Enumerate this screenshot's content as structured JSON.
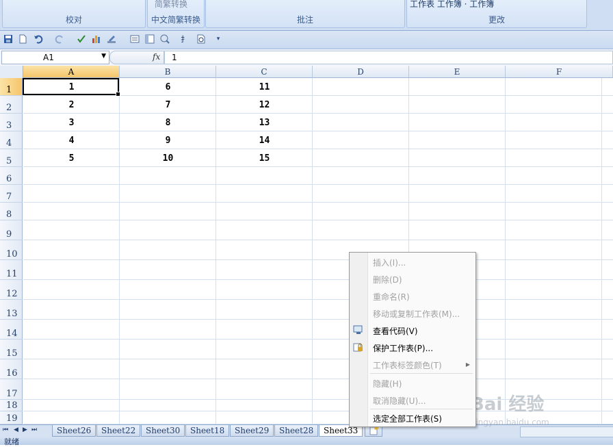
{
  "ribbon": {
    "groups": [
      {
        "label": "校对"
      },
      {
        "label": "中文简繁转换",
        "partial_text": "简繁转换"
      },
      {
        "label": "批注"
      },
      {
        "label": "更改",
        "partial_text": "工作表 工作簿 · 工作簿"
      }
    ]
  },
  "toolbar": {
    "icons": [
      "save-icon",
      "new-icon",
      "undo-icon",
      "redo-icon",
      "spellcheck-icon",
      "chart-icon",
      "edit-icon",
      "form-icon",
      "pivot-icon",
      "reference-icon",
      "translate-icon",
      "print-preview-icon",
      "customize-icon"
    ]
  },
  "formula_bar": {
    "name_box": "A1",
    "fx_label": "fx",
    "formula": "1"
  },
  "sheet": {
    "columns": [
      "A",
      "B",
      "C",
      "D",
      "E",
      "F"
    ],
    "rows": [
      "1",
      "2",
      "3",
      "4",
      "5",
      "6",
      "7",
      "8",
      "9",
      "10",
      "11",
      "12",
      "13",
      "14",
      "15",
      "16",
      "17",
      "18",
      "19"
    ],
    "cells": [
      [
        "1",
        "6",
        "11"
      ],
      [
        "2",
        "7",
        "12"
      ],
      [
        "3",
        "8",
        "13"
      ],
      [
        "4",
        "9",
        "14"
      ],
      [
        "5",
        "10",
        "15"
      ]
    ],
    "active_cell": "A1"
  },
  "tabs": {
    "nav": [
      "⏮",
      "◀",
      "▶",
      "⏭"
    ],
    "items": [
      "Sheet26",
      "Sheet22",
      "Sheet30",
      "Sheet18",
      "Sheet29",
      "Sheet28",
      "Sheet33"
    ],
    "active": "Sheet33"
  },
  "status": {
    "text": "就绪"
  },
  "context_menu": {
    "items": [
      {
        "label": "插入(I)...",
        "enabled": false
      },
      {
        "label": "删除(D)",
        "enabled": false
      },
      {
        "label": "重命名(R)",
        "enabled": false
      },
      {
        "label": "移动或复制工作表(M)...",
        "enabled": false
      },
      {
        "label": "查看代码(V)",
        "enabled": true,
        "icon": "view-code-icon"
      },
      {
        "label": "保护工作表(P)...",
        "enabled": true,
        "icon": "protect-sheet-icon"
      },
      {
        "label": "工作表标签颜色(T)",
        "enabled": false,
        "submenu": true
      },
      {
        "label": "隐藏(H)",
        "enabled": false
      },
      {
        "label": "取消隐藏(U)...",
        "enabled": false
      },
      {
        "label": "选定全部工作表(S)",
        "enabled": true
      }
    ]
  },
  "watermark": {
    "brand": "Bai 经验",
    "url": "jingyan.baidu.com"
  }
}
